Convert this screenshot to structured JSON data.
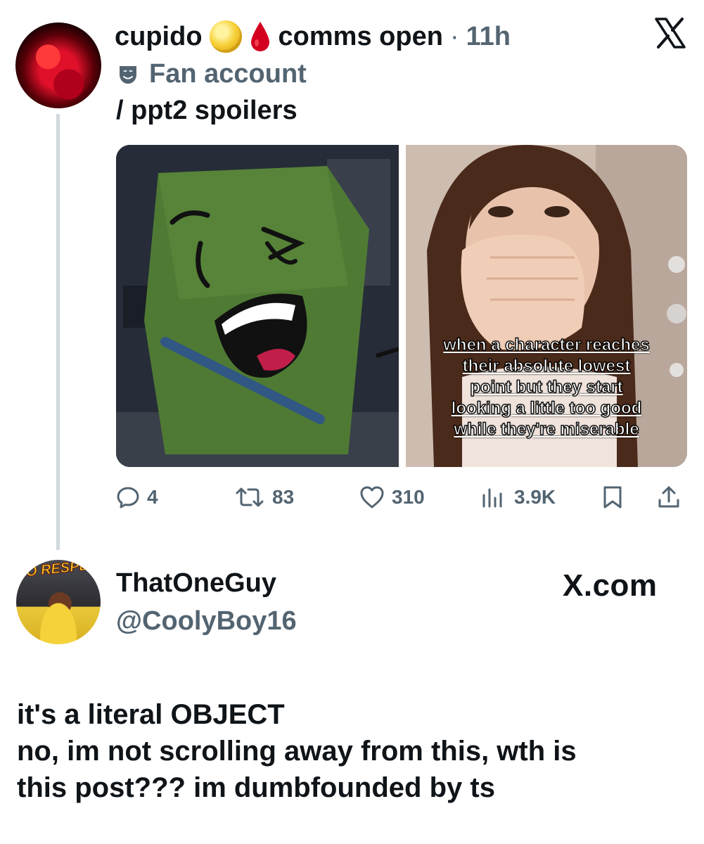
{
  "tweet": {
    "display_name": "cupido",
    "name_suffix": "comms open",
    "separator": "·",
    "time": "11h",
    "icons": [
      "full-moon-emoji",
      "blood-drop-emoji",
      "x-logo-icon",
      "mask-icon"
    ],
    "label": "Fan account",
    "text": "/ ppt2 spoilers",
    "media": {
      "left_description_name": "cartoon-green-character-image",
      "right_description_name": "woman-covering-mouth-image",
      "caption_lines": [
        "when a character reaches",
        "their absolute lowest",
        "point but they start",
        "looking a little too good",
        "while they're miserable"
      ]
    },
    "actions": {
      "replies": "4",
      "reposts": "83",
      "likes": "310",
      "views": "3.9K"
    },
    "colors": {
      "secondary_text": "#536471",
      "thread_line": "#cfd9de"
    }
  },
  "reply": {
    "avatar_text": "HIO RESPEC",
    "display_name": "ThatOneGuy",
    "handle": "@CoolyBoy16",
    "watermark": "X.com",
    "text_lines": [
      "it's a literal OBJECT",
      "no, im not scrolling away from this, wth is",
      "this post??? im dumbfounded by ts"
    ]
  }
}
